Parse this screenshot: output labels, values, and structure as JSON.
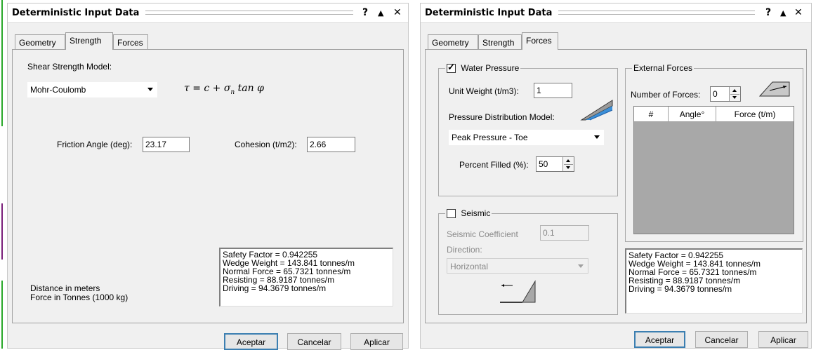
{
  "left_dialog": {
    "title": "Deterministic Input Data",
    "help": "?",
    "minimize": "▲",
    "close": "✕",
    "tabs": [
      "Geometry",
      "Strength",
      "Forces"
    ],
    "active_tab": "Strength",
    "strength": {
      "model_label": "Shear Strength Model:",
      "model_value": "Mohr-Coulomb",
      "formula": {
        "tau": "τ",
        "eq": " = c + σ",
        "sub": "n",
        "rest": " tan φ"
      },
      "friction_label": "Friction Angle (deg):",
      "friction_value": "23.17",
      "cohesion_label": "Cohesion (t/m2):",
      "cohesion_value": "2.66",
      "units_distance": "Distance in meters",
      "units_force": "Force in Tonnes (1000 kg)"
    },
    "results": [
      "Safety Factor = 0.942255",
      "Wedge Weight = 143.841 tonnes/m",
      "Normal Force = 65.7321 tonnes/m",
      "Resisting = 88.9187 tonnes/m",
      "Driving = 94.3679 tonnes/m"
    ],
    "buttons": {
      "ok": "Aceptar",
      "cancel": "Cancelar",
      "apply": "Aplicar"
    }
  },
  "right_dialog": {
    "title": "Deterministic Input Data",
    "help": "?",
    "minimize": "▲",
    "close": "✕",
    "tabs": [
      "Geometry",
      "Strength",
      "Forces"
    ],
    "active_tab": "Forces",
    "water": {
      "group_label": "Water Pressure",
      "checked": true,
      "unit_weight_label": "Unit Weight (t/m3):",
      "unit_weight_value": "1",
      "dist_model_label": "Pressure Distribution Model:",
      "dist_model_value": "Peak Pressure - Toe",
      "percent_label": "Percent Filled (%):",
      "percent_value": "50"
    },
    "seismic": {
      "group_label": "Seismic",
      "checked": false,
      "coef_label": "Seismic Coefficient",
      "coef_value": "0.1",
      "direction_label": "Direction:",
      "direction_value": "Horizontal"
    },
    "external": {
      "group_label": "External Forces",
      "count_label": "Number of Forces:",
      "count_value": "0",
      "columns": [
        "#",
        "Angle°",
        "Force (t/m)"
      ]
    },
    "results": [
      "Safety Factor = 0.942255",
      "Wedge Weight = 143.841 tonnes/m",
      "Normal Force = 65.7321 tonnes/m",
      "Resisting = 88.9187 tonnes/m",
      "Driving = 94.3679 tonnes/m"
    ],
    "buttons": {
      "ok": "Aceptar",
      "cancel": "Cancelar",
      "apply": "Aplicar"
    }
  },
  "colors": {
    "left_edge_green": "#29a829",
    "left_edge_purple": "#7a1f7a",
    "selection_blue": "#3c7fb1"
  }
}
